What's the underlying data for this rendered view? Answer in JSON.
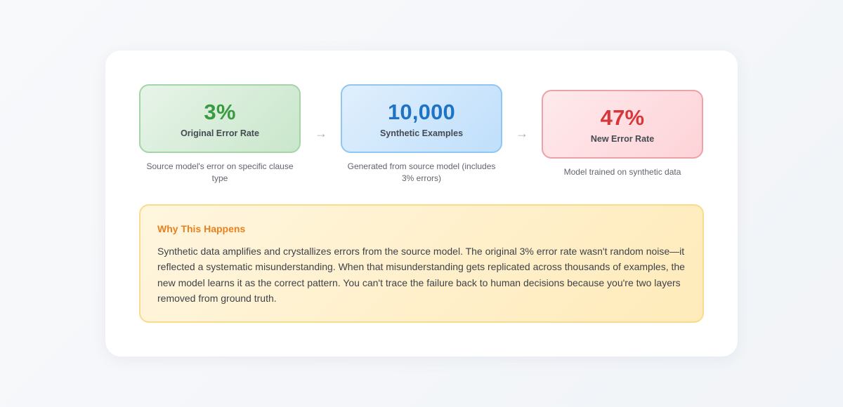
{
  "steps": [
    {
      "value": "3%",
      "label": "Original Error Rate",
      "description": "Source model's error on specific clause type",
      "color": "#3a9a41"
    },
    {
      "value": "10,000",
      "label": "Synthetic Examples",
      "description": "Generated from source model (includes 3% errors)",
      "color": "#1f73c6"
    },
    {
      "value": "47%",
      "label": "New Error Rate",
      "description": "Model trained on synthetic data",
      "color": "#d9363a"
    }
  ],
  "arrow_glyph": "→",
  "explanation": {
    "title": "Why This Happens",
    "body": "Synthetic data amplifies and crystallizes errors from the source model. The original 3% error rate wasn't random noise—it reflected a systematic misunderstanding. When that misunderstanding gets replicated across thousands of examples, the new model learns it as the correct pattern. You can't trace the failure back to human decisions because you're two layers removed from ground truth.",
    "accent_color": "#e8811d"
  }
}
